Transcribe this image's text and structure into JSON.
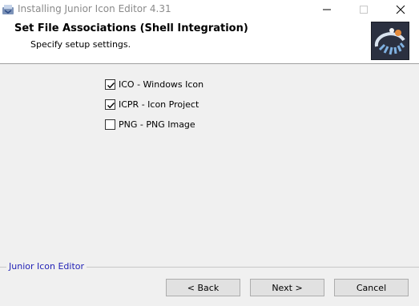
{
  "window": {
    "title": "Installing Junior Icon Editor 4.31"
  },
  "header": {
    "title": "Set File Associations (Shell Integration)",
    "subtitle": "Specify setup settings."
  },
  "associations": [
    {
      "label": "ICO - Windows Icon",
      "checked": true
    },
    {
      "label": "ICPR - Icon Project",
      "checked": true
    },
    {
      "label": "PNG - PNG Image",
      "checked": false
    }
  ],
  "footer": {
    "brand": "Junior Icon Editor",
    "back_label": "< Back",
    "next_label": "Next >",
    "cancel_label": "Cancel"
  },
  "colors": {
    "brand_text": "#1f1fb5",
    "dialog_bg": "#f0f0f0"
  }
}
